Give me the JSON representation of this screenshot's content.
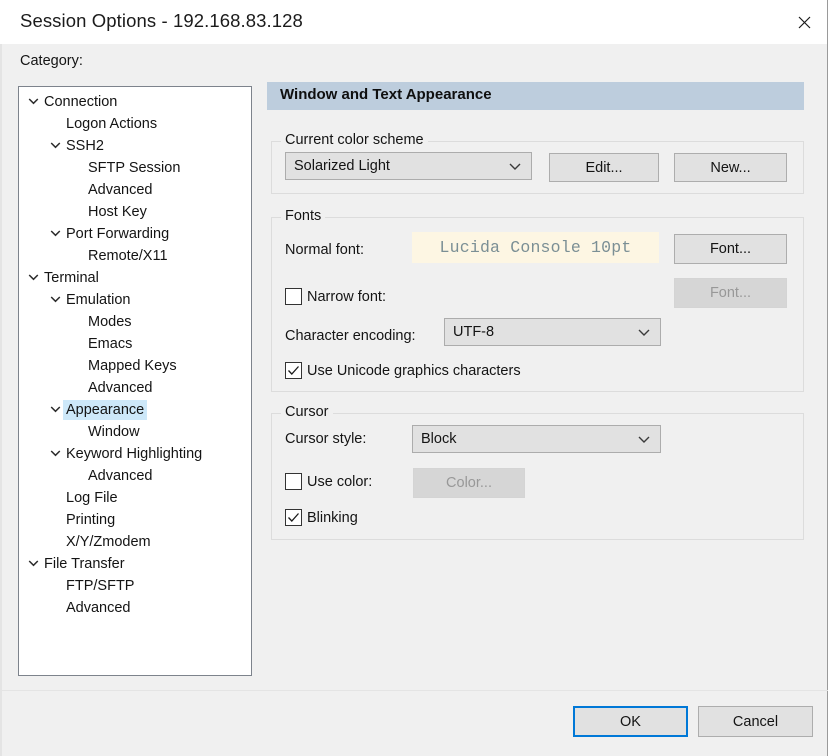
{
  "window": {
    "title": "Session Options - 192.168.83.128",
    "close_icon": "close-icon"
  },
  "sidebar": {
    "label": "Category:",
    "items": [
      {
        "label": "Connection",
        "level": 0,
        "expander": "chevron-down-icon",
        "selected": false
      },
      {
        "label": "Logon Actions",
        "level": 1,
        "expander": "",
        "selected": false
      },
      {
        "label": "SSH2",
        "level": 1,
        "expander": "chevron-down-icon",
        "selected": false
      },
      {
        "label": "SFTP Session",
        "level": 2,
        "expander": "",
        "selected": false
      },
      {
        "label": "Advanced",
        "level": 2,
        "expander": "",
        "selected": false
      },
      {
        "label": "Host Key",
        "level": 2,
        "expander": "",
        "selected": false
      },
      {
        "label": "Port Forwarding",
        "level": 1,
        "expander": "chevron-down-icon",
        "selected": false
      },
      {
        "label": "Remote/X11",
        "level": 2,
        "expander": "",
        "selected": false
      },
      {
        "label": "Terminal",
        "level": 0,
        "expander": "chevron-down-icon",
        "selected": false
      },
      {
        "label": "Emulation",
        "level": 1,
        "expander": "chevron-down-icon",
        "selected": false
      },
      {
        "label": "Modes",
        "level": 2,
        "expander": "",
        "selected": false
      },
      {
        "label": "Emacs",
        "level": 2,
        "expander": "",
        "selected": false
      },
      {
        "label": "Mapped Keys",
        "level": 2,
        "expander": "",
        "selected": false
      },
      {
        "label": "Advanced",
        "level": 2,
        "expander": "",
        "selected": false
      },
      {
        "label": "Appearance",
        "level": 1,
        "expander": "chevron-down-icon",
        "selected": true
      },
      {
        "label": "Window",
        "level": 2,
        "expander": "",
        "selected": false
      },
      {
        "label": "Keyword Highlighting",
        "level": 1,
        "expander": "chevron-down-icon",
        "selected": false
      },
      {
        "label": "Advanced",
        "level": 2,
        "expander": "",
        "selected": false
      },
      {
        "label": "Log File",
        "level": 1,
        "expander": "",
        "selected": false
      },
      {
        "label": "Printing",
        "level": 1,
        "expander": "",
        "selected": false
      },
      {
        "label": "X/Y/Zmodem",
        "level": 1,
        "expander": "",
        "selected": false
      },
      {
        "label": "File Transfer",
        "level": 0,
        "expander": "chevron-down-icon",
        "selected": false
      },
      {
        "label": "FTP/SFTP",
        "level": 1,
        "expander": "",
        "selected": false
      },
      {
        "label": "Advanced",
        "level": 1,
        "expander": "",
        "selected": false
      }
    ]
  },
  "panel": {
    "header": "Window and Text Appearance",
    "header_bg": "#bdcddd",
    "color_scheme": {
      "group_title": "Current color scheme",
      "selected": "Solarized Light",
      "dropdown_icon": "chevron-down-icon",
      "edit_button": "Edit...",
      "new_button": "New..."
    },
    "fonts": {
      "group_title": "Fonts",
      "normal_font_label": "Normal font:",
      "normal_font_value": "Lucida Console 10pt",
      "normal_font_preview_bg": "#fdf6e3",
      "normal_font_preview_fg": "#7b8f95",
      "normal_font_button": "Font...",
      "narrow_font_label": "Narrow font:",
      "narrow_font_checked": false,
      "narrow_font_button": "Font...",
      "narrow_font_button_enabled": false,
      "encoding_label": "Character encoding:",
      "encoding_value": "UTF-8",
      "encoding_dropdown_icon": "chevron-down-icon",
      "unicode_graphics_label": "Use Unicode graphics characters",
      "unicode_graphics_checked": true
    },
    "cursor": {
      "group_title": "Cursor",
      "style_label": "Cursor style:",
      "style_value": "Block",
      "style_dropdown_icon": "chevron-down-icon",
      "use_color_label": "Use color:",
      "use_color_checked": false,
      "color_button": "Color...",
      "color_button_enabled": false,
      "blinking_label": "Blinking",
      "blinking_checked": true
    }
  },
  "footer": {
    "ok_label": "OK",
    "cancel_label": "Cancel",
    "default_button_color": "#0078d7"
  }
}
